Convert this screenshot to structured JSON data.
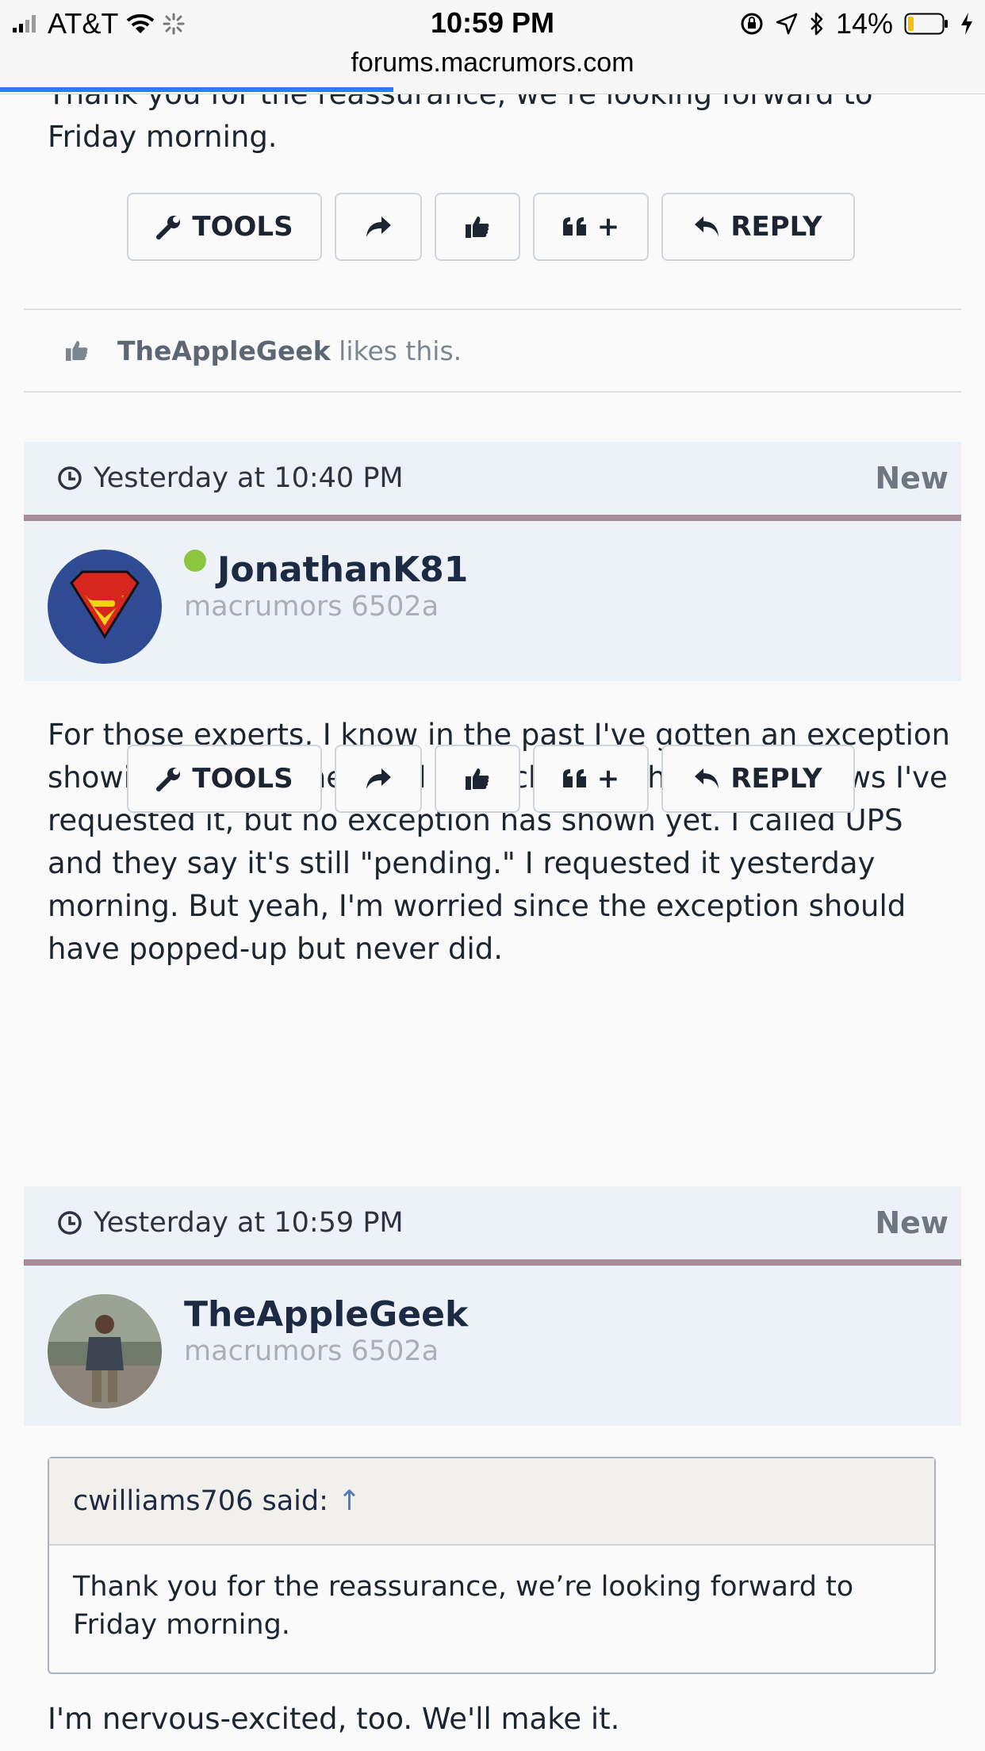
{
  "status_bar": {
    "carrier": "AT&T",
    "time": "10:59 PM",
    "battery": "14%",
    "url": "forums.macrumors.com",
    "page_load_progress": 0.4
  },
  "posts": [
    {
      "body_cut": "Thank you for the reassurance, we’re looking forward to Friday morning."
    },
    {
      "date": "Yesterday at 10:40 PM",
      "new_label": "New",
      "username": "JonathanK81",
      "user_title": "macrumors 6502a",
      "online": true,
      "body": "For those experts, I know in the past I've gotten an exception showing once I scheduled for pickup. Right now, it shows I've requested it, but no exception has shown yet. I called UPS and they say it's still \"pending.\" I requested it yesterday morning. But yeah, I'm worried since the exception should have popped-up but never did."
    },
    {
      "date": "Yesterday at 10:59 PM",
      "new_label": "New",
      "username": "TheAppleGeek",
      "user_title": "macrumors 6502a",
      "quote": {
        "author": "cwilliams706 said:",
        "arrow": "↑",
        "text": "Thank you for the reassurance, we’re looking forward to Friday morning."
      },
      "body": "I'm nervous-excited, too. We'll make it."
    }
  ],
  "actions": {
    "tools": "TOOLS",
    "multiquote_plus": "+",
    "reply": "REPLY"
  },
  "likes": {
    "user": "TheAppleGeek",
    "suffix": "likes this."
  },
  "icons": [
    "signal-icon",
    "wifi-icon",
    "loading-icon",
    "rotation-lock-icon",
    "location-icon",
    "bluetooth-icon",
    "battery-icon",
    "charging-icon",
    "wrench-icon",
    "share-icon",
    "thumbs-up-icon",
    "quote-icon",
    "reply-icon",
    "clock-icon"
  ],
  "colors": {
    "header_bg": "#edf2f9",
    "header_border": "#a98c9a",
    "online": "#8cc63f",
    "progress": "#2f7cf6",
    "username": "#1d2a43"
  }
}
